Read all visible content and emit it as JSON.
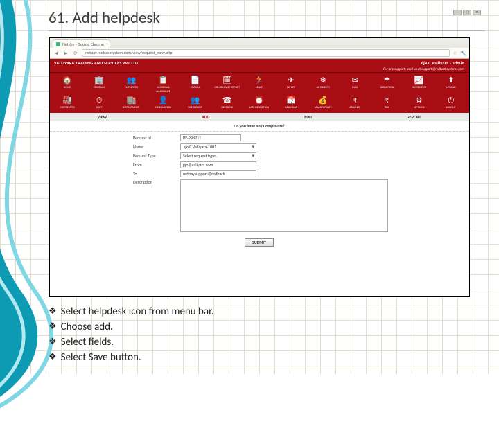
{
  "slide": {
    "title": "61. Add helpdesk",
    "bullets": [
      "Select helpdesk icon from menu bar.",
      "Choose add.",
      "Select fields.",
      "Select Save button."
    ]
  },
  "browser": {
    "tab_title": "NetKey - Google Chrome",
    "url": "netpay.redbacksystem.com/view/request_view.php"
  },
  "app": {
    "company": "VALLIYARA TRADING AND SERVICES PVT LTD",
    "user": "Jijo C Valliyara - admin",
    "support_line": "For any support, mail us at support@redbacksystems.com"
  },
  "nav": {
    "row1": [
      {
        "icon": "🏠",
        "label": "HOME"
      },
      {
        "icon": "🏢",
        "label": "COMPANY"
      },
      {
        "icon": "👥",
        "label": "EMPLOYEES"
      },
      {
        "icon": "📋",
        "label": "INDIVIDUAL ALLOWANCE"
      },
      {
        "icon": "📄",
        "label": "PAYROLL"
      },
      {
        "icon": "🗓",
        "label": "CONSOLIDATE REPORT"
      },
      {
        "icon": "🏃",
        "label": "LEAVE"
      },
      {
        "icon": "✈",
        "label": "FLY OFF"
      },
      {
        "icon": "❄",
        "label": "AC OBJECTS"
      },
      {
        "icon": "✉",
        "label": "MAIL"
      },
      {
        "icon": "☂",
        "label": "DEDUCTION"
      },
      {
        "icon": "📈",
        "label": "INCREMENT"
      },
      {
        "icon": "⬆",
        "label": "UPLOAD"
      }
    ],
    "row2": [
      {
        "icon": "🏭",
        "label": "COSTCENTER"
      },
      {
        "icon": "⏱",
        "label": "SHIFT"
      },
      {
        "icon": "🏬",
        "label": "DEPARTMENT"
      },
      {
        "icon": "👤",
        "label": "DESIGNATION"
      },
      {
        "icon": "👥",
        "label": "USERGROUP"
      },
      {
        "icon": "☎",
        "label": "HELPDESK"
      },
      {
        "icon": "⏰",
        "label": "LATE DEDUCTION"
      },
      {
        "icon": "📅",
        "label": "CALENDAR"
      },
      {
        "icon": "💰",
        "label": "SALARYUPDATE"
      },
      {
        "icon": "₹",
        "label": "ADVANCE"
      },
      {
        "icon": "₹",
        "label": "TAX"
      },
      {
        "icon": "⚙",
        "label": "SETTINGS"
      },
      {
        "icon": "⏻",
        "label": "LOGOUT"
      }
    ]
  },
  "subtabs": {
    "view": "VIEW",
    "add": "ADD",
    "edit": "EDIT",
    "report": "REPORT"
  },
  "form": {
    "heading": "Do you have any Complaints?",
    "request_id_label": "Request Id",
    "request_id": "RE-298211",
    "name_label": "Name",
    "name": "Jijo C Valliyara-1001",
    "request_type_label": "Request Type",
    "request_type": "Select request type..",
    "from_label": "From",
    "from": "jijo@valiyara.com",
    "to_label": "To",
    "to": "netpaysupport@redback",
    "description_label": "Description",
    "submit": "SUBMIT"
  }
}
